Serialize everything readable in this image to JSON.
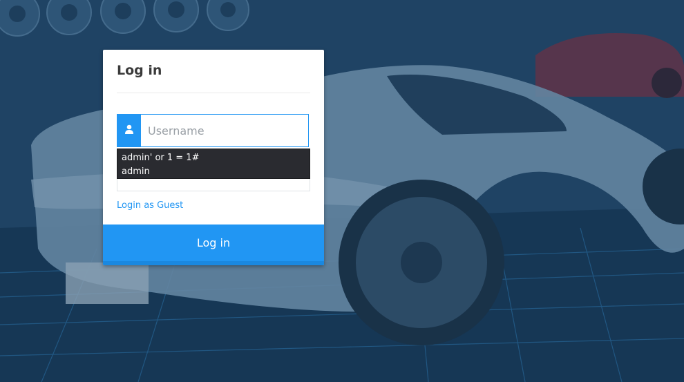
{
  "login": {
    "title": "Log in",
    "username_placeholder": "Username",
    "username_value": "",
    "guest_link": "Login as Guest",
    "submit_label": "Log in"
  },
  "autocomplete": {
    "suggestions": [
      "admin' or 1 = 1#",
      "admin"
    ]
  },
  "icons": {
    "username_addon": "user-icon"
  },
  "colors": {
    "accent": "#2196f3",
    "card_bg": "#ffffff",
    "background": "#1d3d5c",
    "autocomplete_bg": "#2a2b30"
  }
}
